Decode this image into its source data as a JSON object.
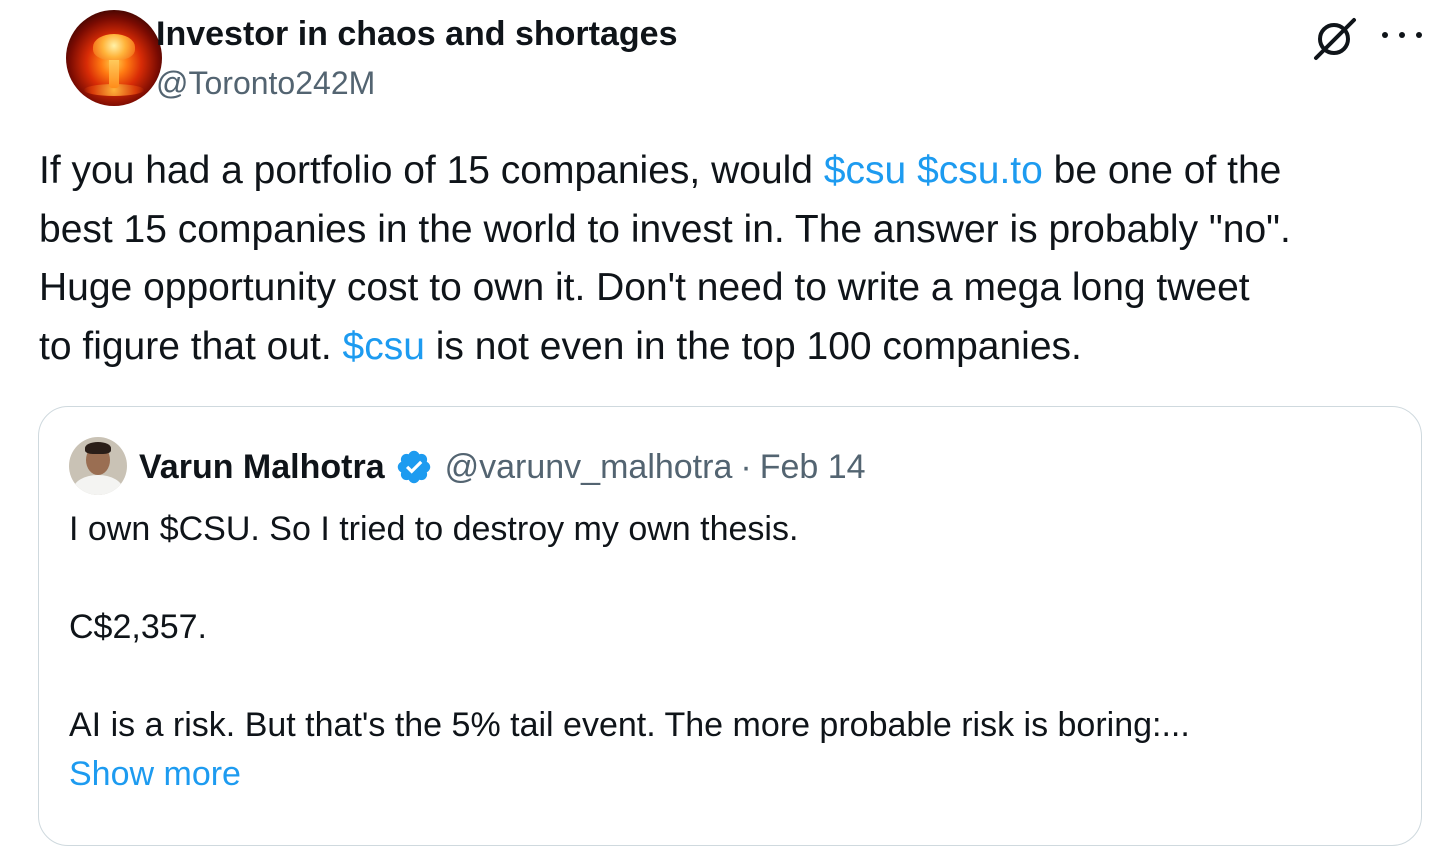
{
  "colors": {
    "text_primary": "#0f1419",
    "text_secondary": "#536471",
    "link": "#1d9bf0",
    "border": "#cfd9de",
    "verified": "#1d9bf0"
  },
  "author": {
    "display_name": "Investor in chaos and shortages",
    "handle": "@Toronto242M",
    "avatar_icon": "mushroom-cloud-avatar"
  },
  "actions": {
    "grok_icon": "grok-icon",
    "more_icon": "more-options-icon"
  },
  "tweet": {
    "line1_pre": "If you had a portfolio of 15 companies, would ",
    "line1_tag1": "$csu",
    "line1_space": " ",
    "line1_tag2": "$csu.to",
    "line1_post": " be one of the",
    "line2": "best 15 companies in the world to invest in. The answer is probably \"no\".",
    "line3": "Huge opportunity cost to own it. Don't need to write a mega long tweet",
    "line4_pre": "to figure that out. ",
    "line4_tag": "$csu",
    "line4_post": " is not even in the top 100 companies."
  },
  "quoted_tweet": {
    "display_name": "Varun Malhotra",
    "verified": true,
    "handle": "@varunv_malhotra",
    "separator": "·",
    "date": "Feb 14",
    "body_line1": "I own $CSU. So I tried to destroy my own thesis.",
    "body_line2": "C$2,357.",
    "body_line3": "AI is a risk. But that's the 5% tail event. The more probable risk is boring:...",
    "show_more": "Show more"
  }
}
